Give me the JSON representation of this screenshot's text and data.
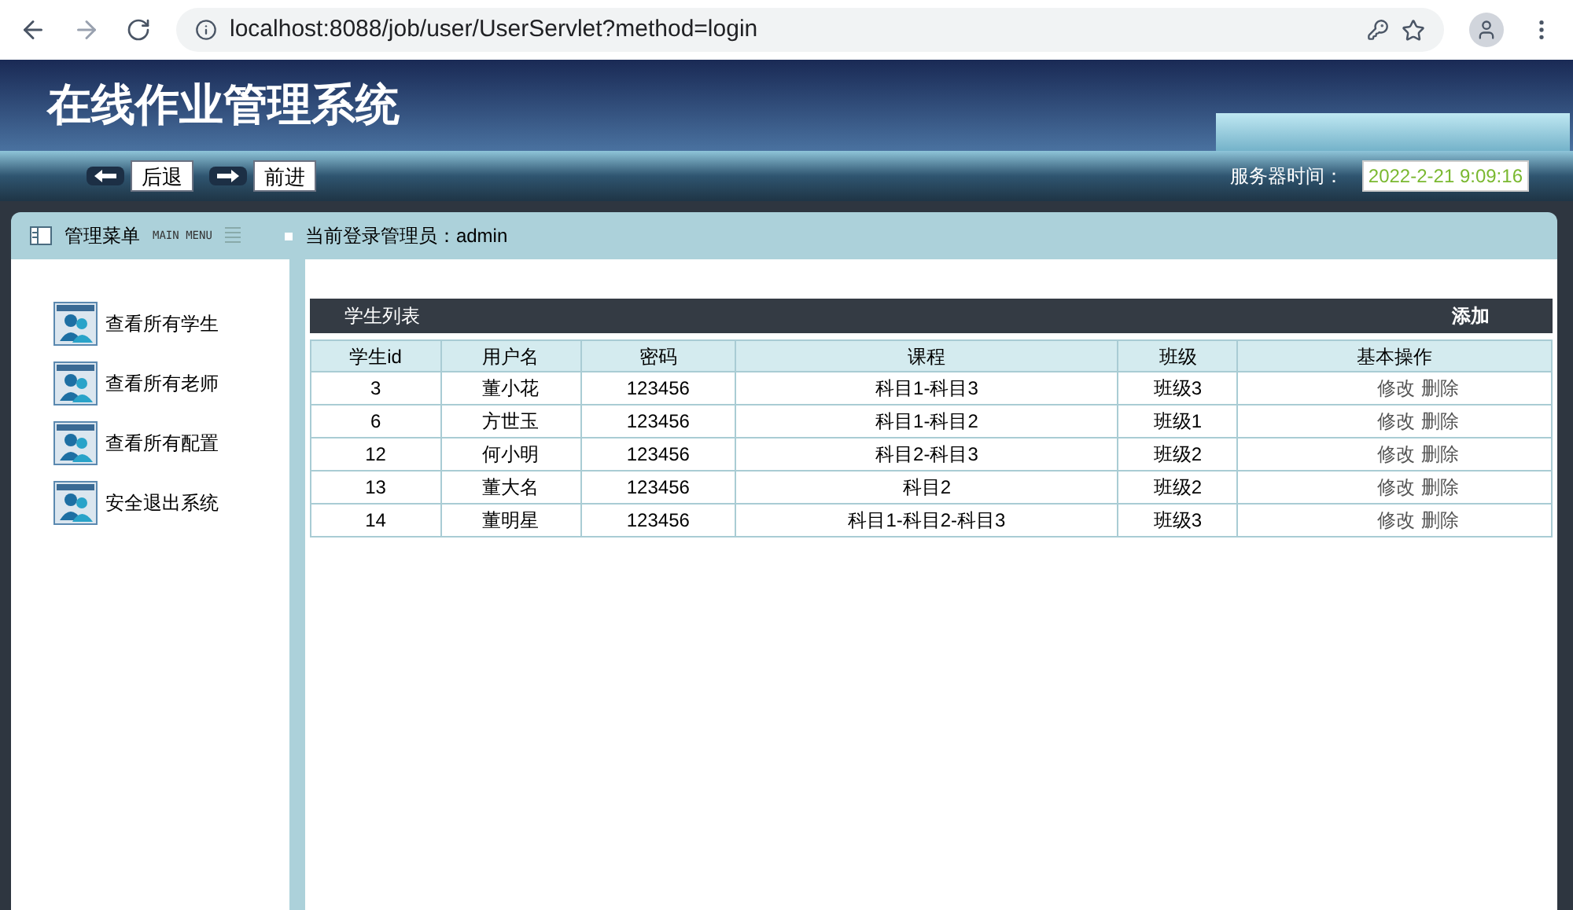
{
  "browser": {
    "url": "localhost:8088/job/user/UserServlet?method=login"
  },
  "header": {
    "title": "在线作业管理系统"
  },
  "nav": {
    "back": "后退",
    "forward": "前进",
    "time_label": "服务器时间：",
    "time": "2022-2-21 9:09:16"
  },
  "panel": {
    "menu_title": "管理菜单",
    "menu_subtitle": "MAIN MENU",
    "login_info": "当前登录管理员：admin"
  },
  "sidebar": {
    "items": [
      {
        "label": "查看所有学生"
      },
      {
        "label": "查看所有老师"
      },
      {
        "label": "查看所有配置"
      },
      {
        "label": "安全退出系统"
      }
    ]
  },
  "table": {
    "title": "学生列表",
    "add": "添加",
    "columns": [
      "学生id",
      "用户名",
      "密码",
      "课程",
      "班级",
      "基本操作"
    ],
    "rows": [
      {
        "cells": [
          "3",
          "董小花",
          "123456",
          "科目1-科目3",
          "班级3"
        ],
        "actions": [
          "修改",
          "删除"
        ]
      },
      {
        "cells": [
          "6",
          "方世玉",
          "123456",
          "科目1-科目2",
          "班级1"
        ],
        "actions": [
          "修改",
          "删除"
        ]
      },
      {
        "cells": [
          "12",
          "何小明",
          "123456",
          "科目2-科目3",
          "班级2"
        ],
        "actions": [
          "修改",
          "删除"
        ]
      },
      {
        "cells": [
          "13",
          "董大名",
          "123456",
          "科目2",
          "班级2"
        ],
        "actions": [
          "修改",
          "删除"
        ]
      },
      {
        "cells": [
          "14",
          "董明星",
          "123456",
          "科目1-科目2-科目3",
          "班级3"
        ],
        "actions": [
          "修改",
          "删除"
        ]
      }
    ]
  }
}
